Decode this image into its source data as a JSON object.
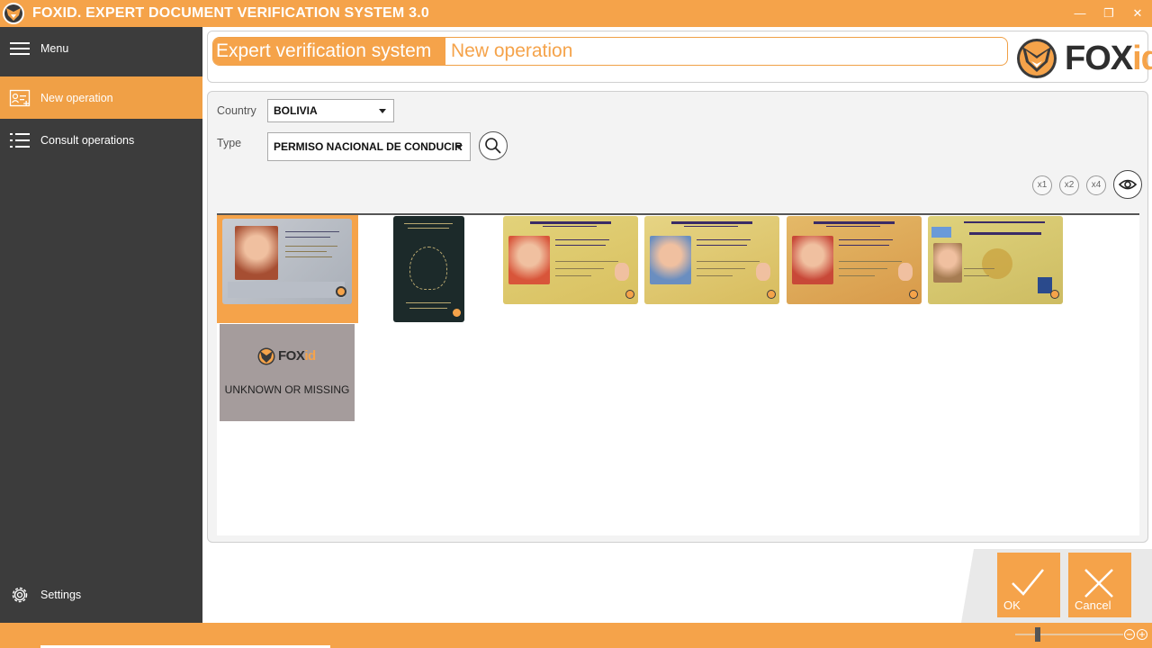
{
  "window": {
    "title": "FOXID. EXPERT DOCUMENT VERIFICATION SYSTEM 3.0",
    "minimize_glyph": "—",
    "restore_glyph": "❐",
    "close_glyph": "✕",
    "accent_color": "#f5a34a",
    "sidebar_color": "#3c3c3c"
  },
  "sidebar": {
    "menu_label": "Menu",
    "items": [
      {
        "label": "New operation",
        "icon": "new-operation-icon",
        "active": true
      },
      {
        "label": "Consult operations",
        "icon": "list-icon",
        "active": false
      }
    ],
    "settings_label": "Settings"
  },
  "header": {
    "crumb_primary": "Expert verification system",
    "crumb_secondary": "New operation",
    "brand_fox": "FOX",
    "brand_id": "id"
  },
  "form": {
    "country_label": "Country",
    "country_value": "BOLIVIA",
    "type_label": "Type",
    "type_value": "PERMISO NACIONAL DE CONDUCIR"
  },
  "zoom": {
    "x1": "x1",
    "x2": "x2",
    "x4": "x4"
  },
  "gallery": {
    "unknown_label": "UNKNOWN OR MISSING",
    "unknown_brand_fox": "FOX",
    "unknown_brand_id": "id",
    "selected_index": 0
  },
  "actions": {
    "ok_label": "OK",
    "cancel_label": "Cancel"
  }
}
